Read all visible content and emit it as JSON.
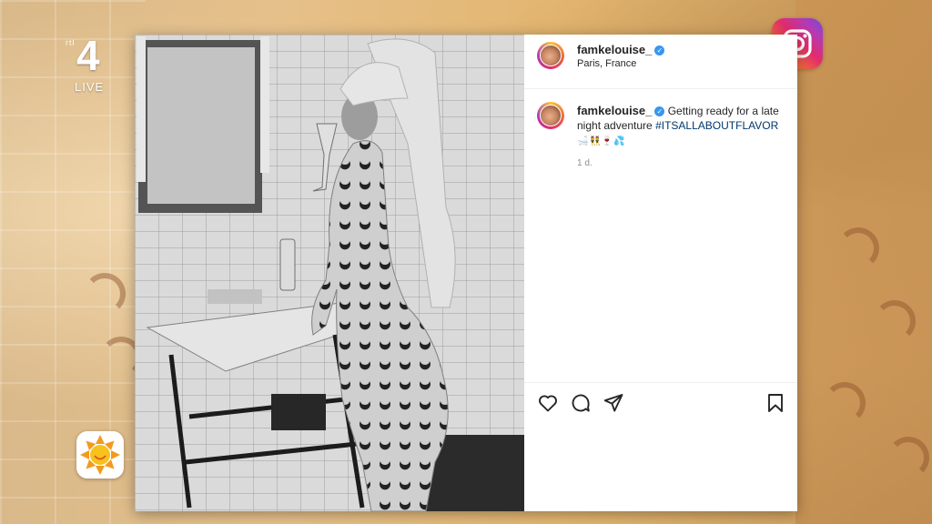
{
  "overlay": {
    "channel": {
      "brand_small": "rtl",
      "number": "4",
      "live_label": "LIVE"
    },
    "instagram_logo_icon": "instagram-logo-icon",
    "show_logo_icon": "sun-logo-icon"
  },
  "post": {
    "header": {
      "username": "famkelouise_",
      "location": "Paris, France",
      "verified": true
    },
    "caption": {
      "username": "famkelouise_",
      "text": "Getting ready for a late night adventure",
      "hashtag": "#ITSALLABOUTFLAVOR",
      "emojis": "🛁👯🍷💦"
    },
    "time_ago": "1 d.",
    "actions": {
      "like_icon": "heart-icon",
      "comment_icon": "comment-icon",
      "share_icon": "send-icon",
      "save_icon": "bookmark-icon"
    }
  },
  "colors": {
    "link": "#00376b",
    "verified_badge": "#3897f0",
    "text": "#262626",
    "muted": "#8e8e8e"
  }
}
